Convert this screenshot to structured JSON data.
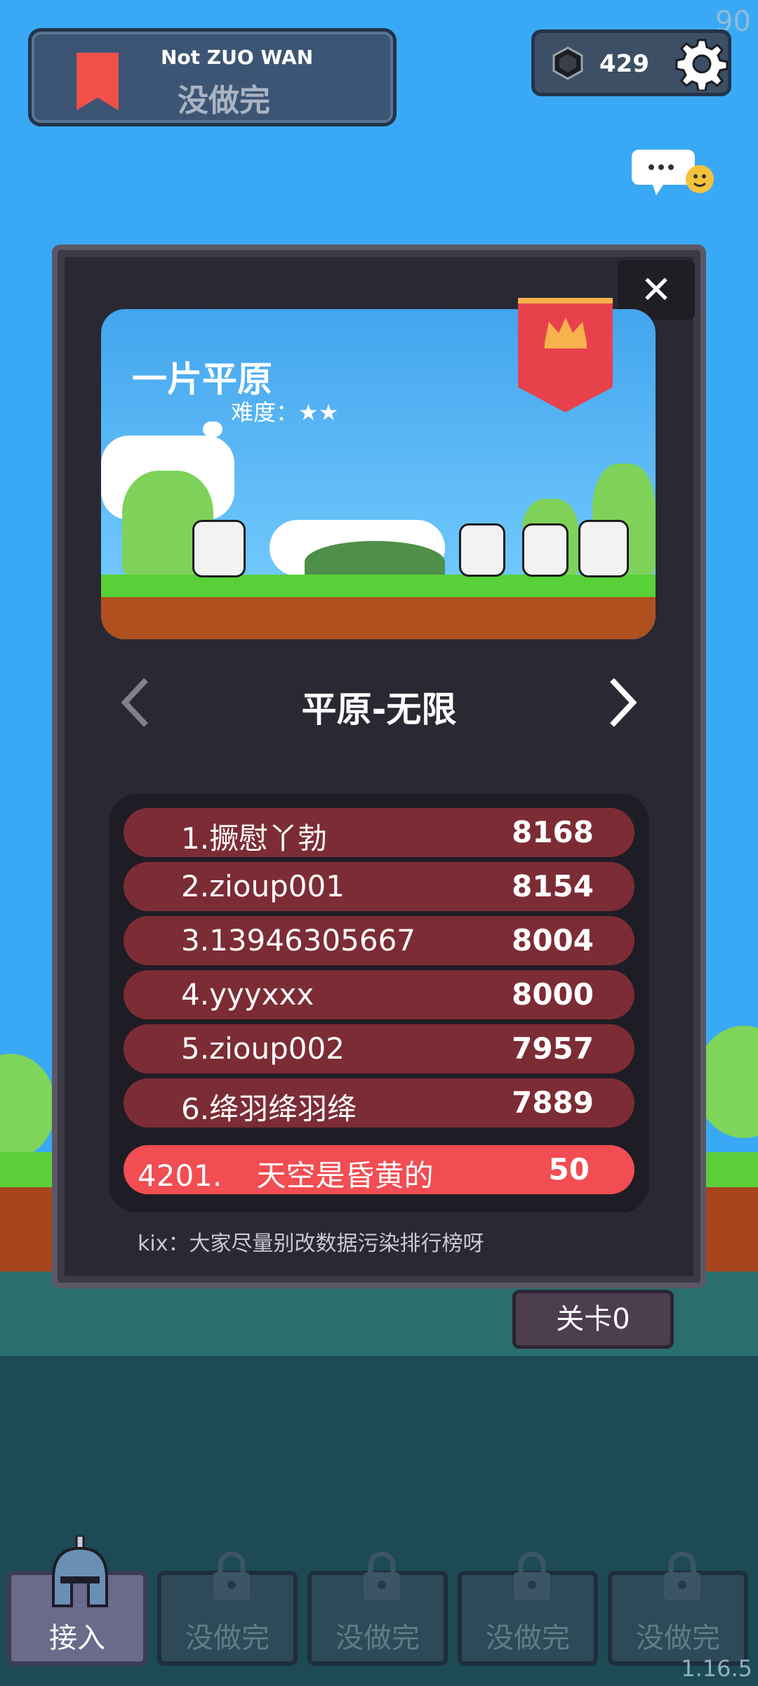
{
  "status": {
    "fps": "90",
    "version": "1.16.5"
  },
  "player": {
    "subtitle": "Not ZUO WAN",
    "title": "没做完"
  },
  "currency": {
    "value": "429",
    "icon": "gem-icon"
  },
  "level": {
    "title": "一片平原",
    "difficulty": "难度：★★",
    "mode": "平原-无限"
  },
  "leaderboard": {
    "rows": [
      {
        "rank_name": "1.撅慰丫勃",
        "score": "8168"
      },
      {
        "rank_name": "2.zioup001",
        "score": "8154"
      },
      {
        "rank_name": "3.13946305667",
        "score": "8004"
      },
      {
        "rank_name": "4.yyyxxx",
        "score": "8000"
      },
      {
        "rank_name": "5.zioup002",
        "score": "7957"
      },
      {
        "rank_name": "6.绛羽绛羽绛",
        "score": "7889"
      }
    ],
    "mine": {
      "rank": "4201.",
      "name": "天空是昏黄的",
      "score": "50"
    },
    "note": "kix：大家尽量别改数据污染排行榜呀"
  },
  "stage_button": "关卡0",
  "tabs": [
    {
      "label": "接入",
      "active": true
    },
    {
      "label": "没做完",
      "active": false
    },
    {
      "label": "没做完",
      "active": false
    },
    {
      "label": "没做完",
      "active": false
    },
    {
      "label": "没做完",
      "active": false
    }
  ],
  "colors": {
    "sky": "#38a8f4",
    "row": "#7c2c35",
    "my_row": "#f14d52",
    "panel": "#2a2833"
  }
}
